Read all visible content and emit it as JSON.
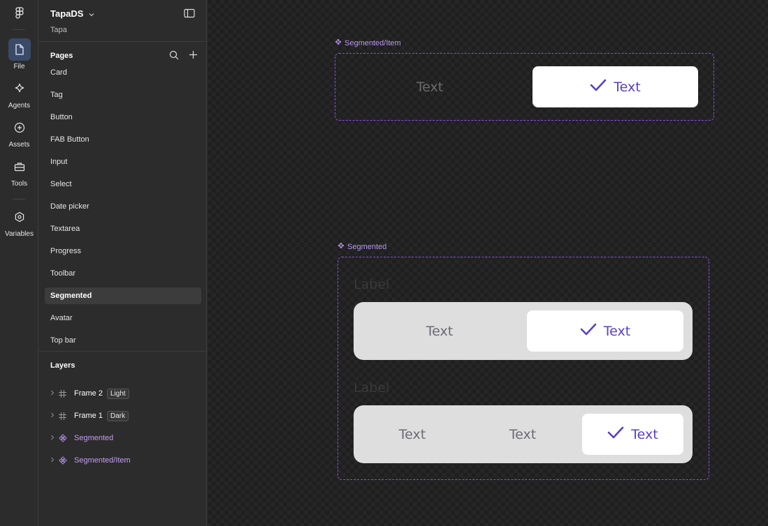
{
  "rail": {
    "items": [
      {
        "label": "File",
        "icon": "file-icon"
      },
      {
        "label": "Agents",
        "icon": "sparkle-icon"
      },
      {
        "label": "Assets",
        "icon": "plus-circle-icon"
      },
      {
        "label": "Tools",
        "icon": "toolbox-icon"
      },
      {
        "label": "Variables",
        "icon": "hexagon-icon"
      }
    ]
  },
  "project": {
    "title": "TapaDS",
    "team": "Tapa"
  },
  "pages": {
    "title": "Pages",
    "items": [
      "Card",
      "Tag",
      "Button",
      "FAB Button",
      "Input",
      "Select",
      "Date picker",
      "Textarea",
      "Progress",
      "Toolbar",
      "Segmented",
      "Avatar",
      "Top bar"
    ],
    "active": "Segmented"
  },
  "layers": {
    "title": "Layers",
    "items": [
      {
        "name": "Frame 2",
        "tag": "Light"
      },
      {
        "name": "Frame 1",
        "tag": "Dark"
      },
      {
        "name": "Segmented"
      },
      {
        "name": "Segmented/Item"
      }
    ]
  },
  "canvas": {
    "item_component": {
      "label": "Segmented/Item",
      "unselected": "Text",
      "selected": "Text"
    },
    "segmented_component": {
      "label": "Segmented",
      "first": {
        "field_label": "Label",
        "options": [
          "Text",
          "Text"
        ]
      },
      "second": {
        "field_label": "Label",
        "options": [
          "Text",
          "Text",
          "Text"
        ]
      }
    }
  },
  "colors": {
    "accent": "#8a4ee6",
    "selected_text": "#5a40c8",
    "component_label": "#b996ef"
  }
}
